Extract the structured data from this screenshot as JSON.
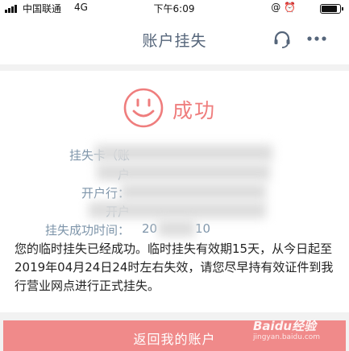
{
  "status_bar": {
    "carrier": "中国联通",
    "network": "4G",
    "time": "下午6:09",
    "icons": "@ ⏰"
  },
  "nav": {
    "title": "账户挂失",
    "title_color": "#55657a"
  },
  "result": {
    "status_text": "成功",
    "accent_color": "#ef7d7d"
  },
  "details": [
    {
      "label": "挂失卡（账",
      "value": ""
    },
    {
      "label": "户",
      "value": ""
    },
    {
      "label": "开户行：",
      "value": ""
    },
    {
      "label": "开户",
      "value": ""
    },
    {
      "label": "挂失成功时间：",
      "value": "20"
    }
  ],
  "details_tail": "10",
  "notice": "您的临时挂失已经成功。临时挂失有效期15天，从今日起至2019年04月24日24时左右失效，请您尽早持有效证件到我行营业网点进行正式挂失。",
  "button": {
    "label": "返回我的账户",
    "color": "#f08a8a"
  },
  "watermark": {
    "logo": "Baidu经验",
    "url": "jingyan.baidu.com"
  }
}
